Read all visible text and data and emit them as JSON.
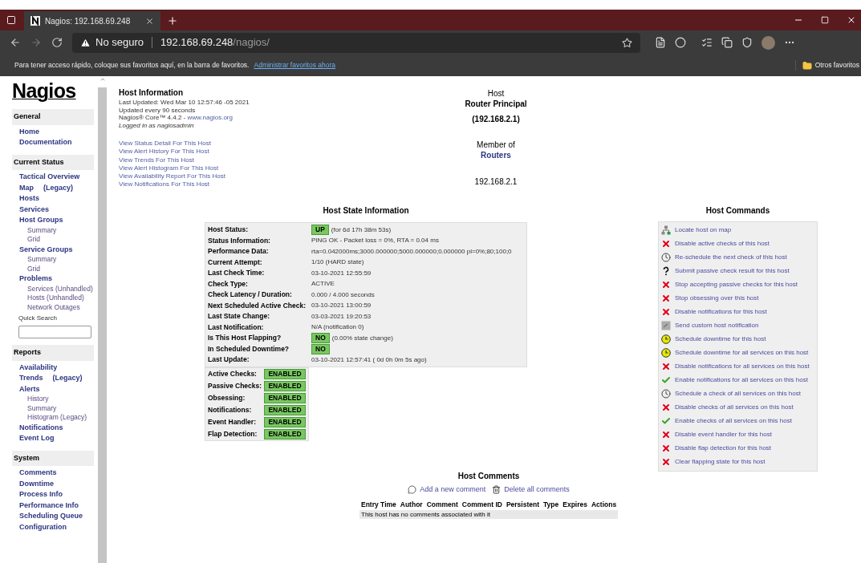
{
  "browser": {
    "tab_title": "Nagios: 192.168.69.248",
    "security": "No seguro",
    "url_host": "192.168.69.248",
    "url_path": "/nagios/",
    "favorites_hint": "Para tener acceso rápido, coloque sus favoritos aquí, en la barra de favoritos.",
    "favorites_link": "Administrar favoritos ahora",
    "other_favorites": "Otros favoritos"
  },
  "logo": "Nagios",
  "sidebar": [
    {
      "title": "General",
      "items": [
        {
          "label": "Home",
          "kind": "main"
        },
        {
          "label": "Documentation",
          "kind": "main"
        }
      ]
    },
    {
      "title": "Current Status",
      "items": [
        {
          "label": "Tactical Overview",
          "kind": "main"
        },
        {
          "label": "Map",
          "kind": "main",
          "extra": "(Legacy)"
        },
        {
          "label": "Hosts",
          "kind": "main"
        },
        {
          "label": "Services",
          "kind": "main"
        },
        {
          "label": "Host Groups",
          "kind": "main"
        },
        {
          "label": "Summary",
          "kind": "sub"
        },
        {
          "label": "Grid",
          "kind": "sub"
        },
        {
          "label": "Service Groups",
          "kind": "main"
        },
        {
          "label": "Summary",
          "kind": "sub"
        },
        {
          "label": "Grid",
          "kind": "sub"
        },
        {
          "label": "Problems",
          "kind": "main"
        },
        {
          "label": "Services (Unhandled)",
          "kind": "sub"
        },
        {
          "label": "Hosts (Unhandled)",
          "kind": "sub"
        },
        {
          "label": "Network Outages",
          "kind": "sub"
        }
      ],
      "search_label": "Quick Search"
    },
    {
      "title": "Reports",
      "items": [
        {
          "label": "Availability",
          "kind": "main"
        },
        {
          "label": "Trends",
          "kind": "main",
          "extra": "(Legacy)"
        },
        {
          "label": "Alerts",
          "kind": "main"
        },
        {
          "label": "History",
          "kind": "sub"
        },
        {
          "label": "Summary",
          "kind": "sub"
        },
        {
          "label": "Histogram (Legacy)",
          "kind": "sub"
        },
        {
          "label": "Notifications",
          "kind": "main"
        },
        {
          "label": "Event Log",
          "kind": "main"
        }
      ]
    },
    {
      "title": "System",
      "items": [
        {
          "label": "Comments",
          "kind": "main"
        },
        {
          "label": "Downtime",
          "kind": "main"
        },
        {
          "label": "Process Info",
          "kind": "main"
        },
        {
          "label": "Performance Info",
          "kind": "main"
        },
        {
          "label": "Scheduling Queue",
          "kind": "main"
        },
        {
          "label": "Configuration",
          "kind": "main"
        }
      ]
    }
  ],
  "host_info": {
    "title": "Host Information",
    "lines": [
      "Last Updated: Wed Mar 10 12:57:46 -05 2021",
      "Updated every 90 seconds"
    ],
    "version": "Nagios® Core™ 4.4.2 - ",
    "version_link": "www.nagios.org",
    "logged_in": "Logged in as nagiosadmin",
    "links": [
      "View Status Detail For This Host",
      "View Alert History For This Host",
      "View Trends For This Host",
      "View Alert Histogram For This Host",
      "View Availability Report For This Host",
      "View Notifications For This Host"
    ]
  },
  "host": {
    "label": "Host",
    "name": "Router Principal",
    "address_paren": "(192.168.2.1)",
    "member_label": "Member of",
    "group": "Routers",
    "address": "192.168.2.1"
  },
  "state": {
    "title": "Host State Information",
    "rows": [
      {
        "label": "Host Status:",
        "kind": "badge",
        "badge": "UP",
        "note": "(for 6d 17h 38m 53s)"
      },
      {
        "label": "Status Information:",
        "kind": "text",
        "value": "PING OK - Packet loss = 0%, RTA = 0.04 ms"
      },
      {
        "label": "Performance Data:",
        "kind": "text",
        "value": "rta=0.042000ms;3000.000000;5000.000000;0.000000 pl=0%;80;100;0"
      },
      {
        "label": "Current Attempt:",
        "kind": "text",
        "value": "1/10  (HARD state)"
      },
      {
        "label": "Last Check Time:",
        "kind": "text",
        "value": "03-10-2021 12:55:59"
      },
      {
        "label": "Check Type:",
        "kind": "text",
        "value": "ACTIVE"
      },
      {
        "label": "Check Latency / Duration:",
        "kind": "text",
        "value": "0.000 / 4.000 seconds"
      },
      {
        "label": "Next Scheduled Active Check:",
        "kind": "text",
        "value": "03-10-2021 13:00:59"
      },
      {
        "label": "Last State Change:",
        "kind": "text",
        "value": "03-03-2021 19:20:53"
      },
      {
        "label": "Last Notification:",
        "kind": "text",
        "value": "N/A (notification 0)"
      },
      {
        "label": "Is This Host Flapping?",
        "kind": "badge",
        "badge": "NO",
        "note": "(0.00% state change)"
      },
      {
        "label": "In Scheduled Downtime?",
        "kind": "badge",
        "badge": "NO"
      },
      {
        "label": "Last Update:",
        "kind": "text",
        "value": "03-10-2021 12:57:41  ( 0d 0h 0m 5s ago)"
      }
    ],
    "features": [
      {
        "label": "Active Checks:",
        "state": "ENABLED",
        "enabled": true
      },
      {
        "label": "Passive Checks:",
        "state": "ENABLED",
        "enabled": true
      },
      {
        "label": "Obsessing:",
        "state": "ENABLED",
        "enabled": true
      },
      {
        "label": "Notifications:",
        "state": "ENABLED",
        "enabled": true
      },
      {
        "label": "Event Handler:",
        "state": "ENABLED",
        "enabled": true
      },
      {
        "label": "Flap Detection:",
        "state": "ENABLED",
        "enabled": true
      }
    ]
  },
  "commands": {
    "title": "Host Commands",
    "items": [
      {
        "label": "Locate host on map",
        "kind": "map"
      },
      {
        "label": "Disable active checks of this host",
        "kind": "disable"
      },
      {
        "label": "Re-schedule the next check of this host",
        "kind": "schedule"
      },
      {
        "label": "Submit passive check result for this host",
        "kind": "submit"
      },
      {
        "label": "Stop accepting passive checks for this host",
        "kind": "disable"
      },
      {
        "label": "Stop obsessing over this host",
        "kind": "disable"
      },
      {
        "label": "Disable notifications for this host",
        "kind": "disable"
      },
      {
        "label": "Send custom host notification",
        "kind": "notify"
      },
      {
        "label": "Schedule downtime for this host",
        "kind": "downtime"
      },
      {
        "label": "Schedule downtime for all services on this host",
        "kind": "downtime"
      },
      {
        "label": "Disable notifications for all services on this host",
        "kind": "disable"
      },
      {
        "label": "Enable notifications for all services on this host",
        "kind": "enable"
      },
      {
        "label": "Schedule a check of all services on this host",
        "kind": "schedule"
      },
      {
        "label": "Disable checks of all services on this host",
        "kind": "disable"
      },
      {
        "label": "Enable checks of all services on this host",
        "kind": "enable"
      },
      {
        "label": "Disable event handler for this host",
        "kind": "disable"
      },
      {
        "label": "Disable flap detection for this host",
        "kind": "disable"
      },
      {
        "label": "Clear flapping state for this host",
        "kind": "disable"
      }
    ]
  },
  "comments": {
    "title": "Host Comments",
    "add": "Add a new comment",
    "delete": "Delete all comments",
    "columns": [
      "Entry Time",
      "Author",
      "Comment",
      "Comment ID",
      "Persistent",
      "Type",
      "Expires",
      "Actions"
    ],
    "empty": "This host has no comments associated with it"
  }
}
